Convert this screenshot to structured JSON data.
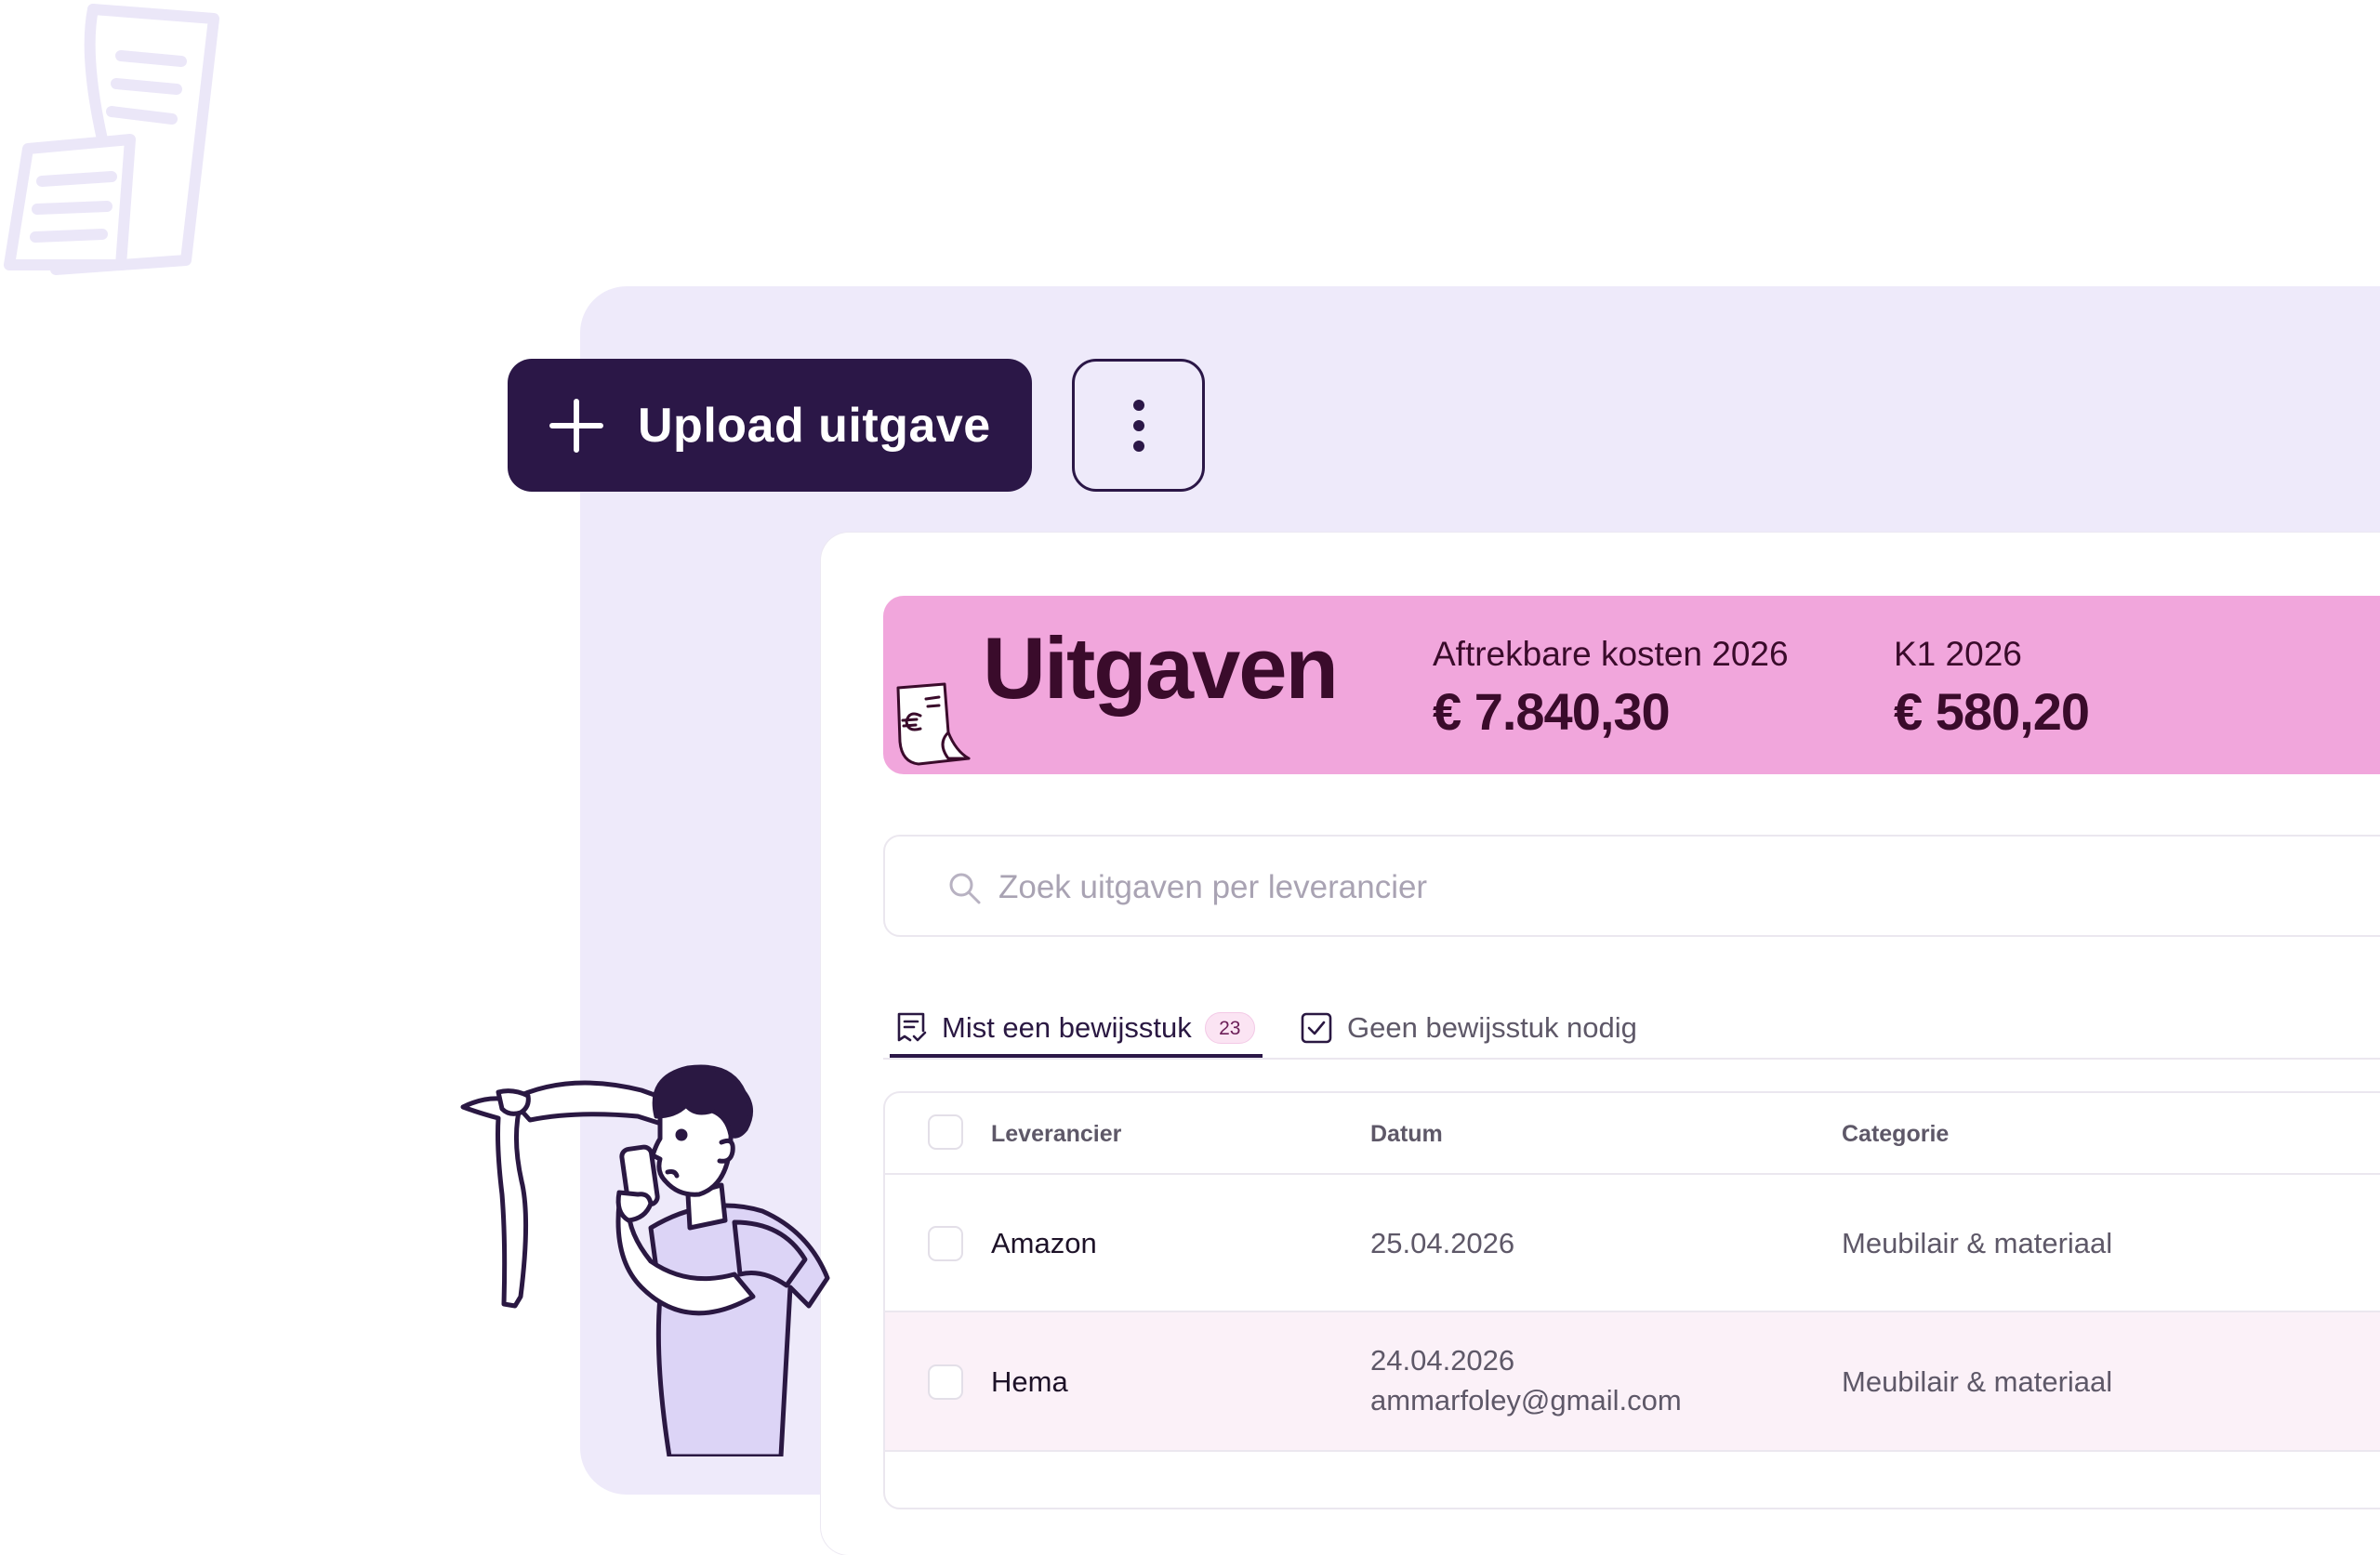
{
  "toolbar": {
    "upload_label": "Upload uitgave",
    "more_icon": "more-vertical-icon"
  },
  "banner": {
    "title": "Uitgaven",
    "stats": [
      {
        "label": "Aftrekbare kosten 2026",
        "value": "€ 7.840,30"
      },
      {
        "label": "K1 2026",
        "value": "€ 580,20"
      }
    ]
  },
  "search": {
    "placeholder": "Zoek uitgaven per leverancier"
  },
  "tabs": [
    {
      "label": "Mist een bewijsstuk",
      "count": "23",
      "icon": "receipt-check-icon",
      "active": true
    },
    {
      "label": "Geen bewijsstuk nodig",
      "icon": "checkbox-icon",
      "active": false
    }
  ],
  "table": {
    "headers": [
      "Leverancier",
      "Datum",
      "Categorie"
    ],
    "rows": [
      {
        "vendor": "Amazon",
        "date": "25.04.2026",
        "email": "",
        "category": "Meubilair & materiaal"
      },
      {
        "vendor": "Hema",
        "date": "24.04.2026",
        "email": "ammarfoley@gmail.com",
        "category": "Meubilair & materiaal"
      }
    ]
  },
  "colors": {
    "primary": "#2b1747",
    "panel": "#eeeafa",
    "banner": "#f1a6dc",
    "highlight_row": "#fbf1f8"
  }
}
